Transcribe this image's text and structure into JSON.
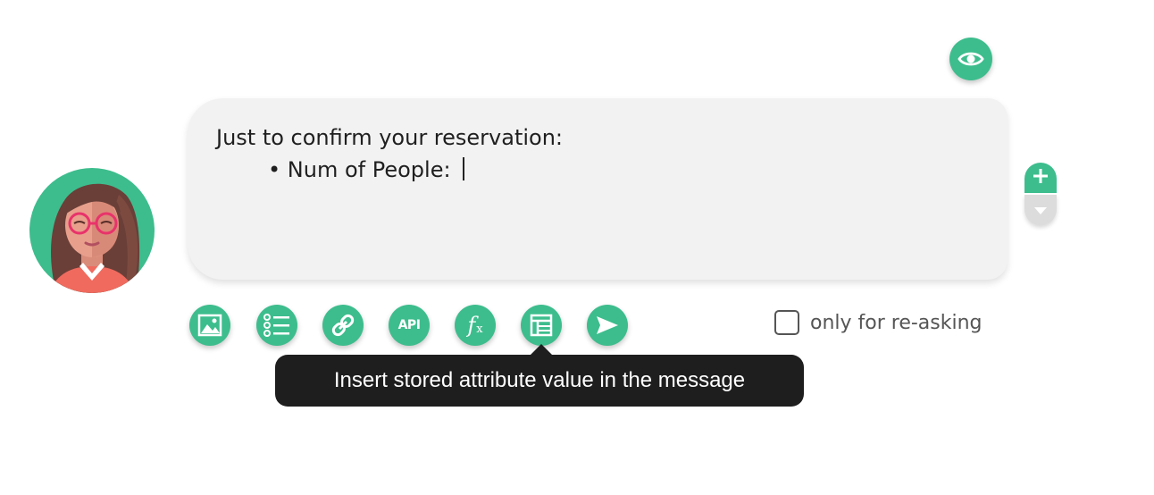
{
  "message": {
    "line1": "Just to confirm your reservation:",
    "line2": "• Num of People: "
  },
  "toolbar": {
    "api_label": "API",
    "function_label": "f",
    "function_sub": "x"
  },
  "reask": {
    "label": "only for re-asking",
    "checked": false
  },
  "tooltip": {
    "text": "Insert stored attribute value in the message"
  },
  "colors": {
    "accent": "#3dbd8d",
    "bubble": "#f2f2f2",
    "tooltip_bg": "#1e1e1e"
  },
  "icons": [
    "eye-icon",
    "plus-icon",
    "caret-down-icon",
    "image-icon",
    "list-icon",
    "link-icon",
    "api-icon",
    "function-icon",
    "table-icon",
    "send-icon"
  ]
}
